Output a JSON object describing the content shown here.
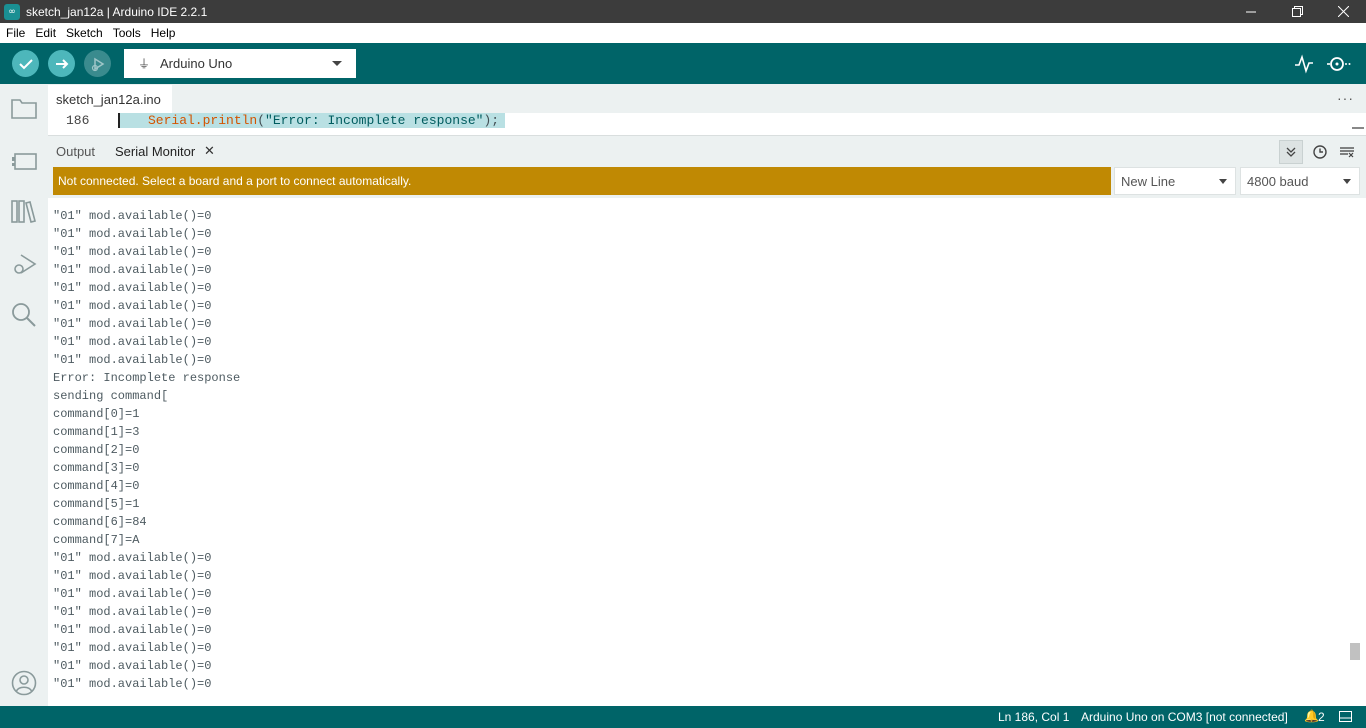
{
  "window": {
    "title": "sketch_jan12a | Arduino IDE 2.2.1",
    "app_icon": "infinity-icon",
    "controls": [
      "minimize-icon",
      "restore-icon",
      "close-icon"
    ]
  },
  "menu": [
    "File",
    "Edit",
    "Sketch",
    "Tools",
    "Help"
  ],
  "toolbar": {
    "buttons": [
      "verify-icon",
      "upload-icon",
      "debug-icon"
    ],
    "board": "Arduino Uno",
    "right_buttons": [
      "serial-plotter-icon",
      "serial-monitor-icon"
    ]
  },
  "sidebar": [
    "folder-icon",
    "boards-manager-icon",
    "library-icon",
    "debug-icon",
    "search-icon",
    "account-icon"
  ],
  "editor": {
    "tab": "sketch_jan12a.ino",
    "line_number": "186",
    "code_fn": "Serial.println",
    "code_open": "(",
    "code_str": "\"Error: Incomplete response\"",
    "code_close": ");"
  },
  "panel": {
    "tabs": [
      "Output",
      "Serial Monitor"
    ],
    "active_tab": "Serial Monitor",
    "notice": "Not connected. Select a board and a port to connect automatically.",
    "line_ending": "New Line",
    "baud": "4800 baud"
  },
  "serial_lines": [
    "\"01\" mod.available()=0",
    "\"01\" mod.available()=0",
    "\"01\" mod.available()=0",
    "\"01\" mod.available()=0",
    "\"01\" mod.available()=0",
    "\"01\" mod.available()=0",
    "\"01\" mod.available()=0",
    "\"01\" mod.available()=0",
    "\"01\" mod.available()=0",
    "Error: Incomplete response",
    "sending command[",
    "command[0]=1",
    "command[1]=3",
    "command[2]=0",
    "command[3]=0",
    "command[4]=0",
    "command[5]=1",
    "command[6]=84",
    "command[7]=A",
    "\"01\" mod.available()=0",
    "\"01\" mod.available()=0",
    "\"01\" mod.available()=0",
    "\"01\" mod.available()=0",
    "\"01\" mod.available()=0",
    "\"01\" mod.available()=0",
    "\"01\" mod.available()=0",
    "\"01\" mod.available()=0"
  ],
  "status": {
    "position": "Ln 186, Col 1",
    "board": "Arduino Uno on COM3 [not connected]",
    "notifications": "2"
  },
  "colors": {
    "teal": "#006468",
    "accent": "#4db7bb",
    "warning": "#c08903"
  }
}
